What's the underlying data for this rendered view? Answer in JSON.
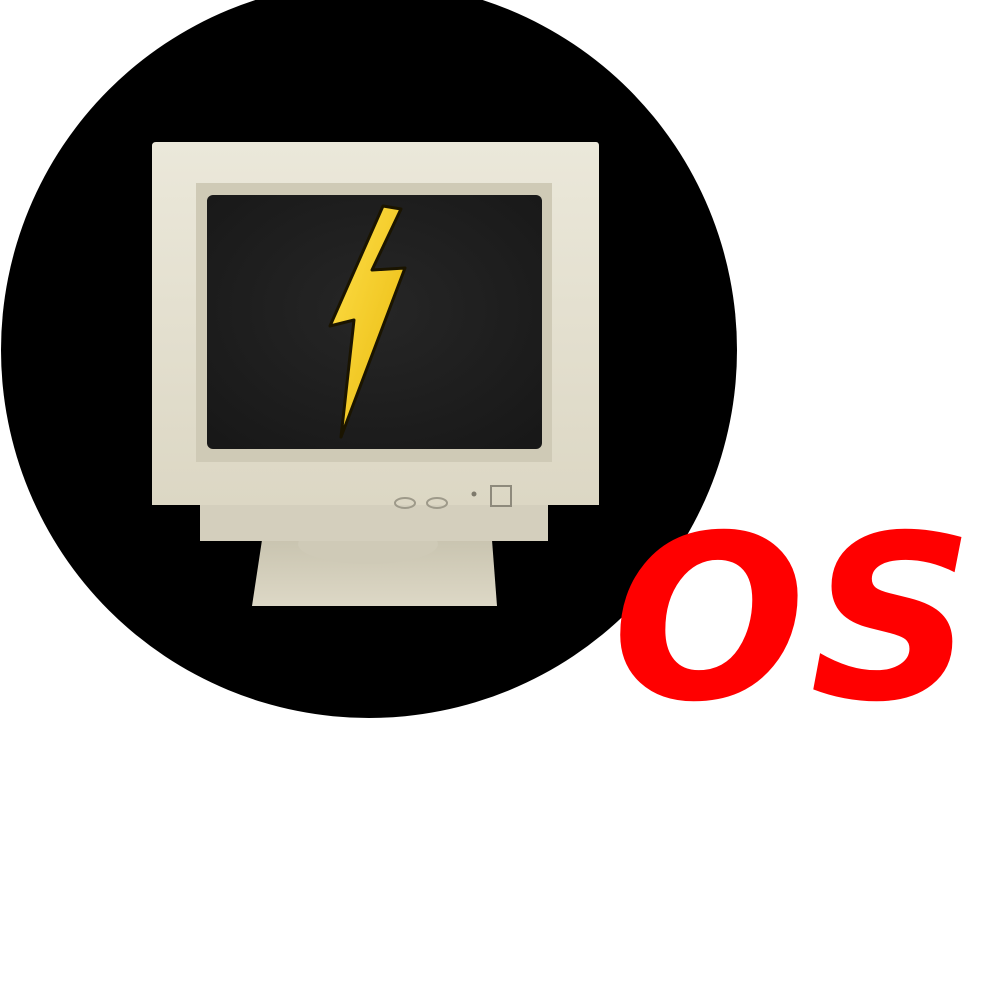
{
  "logo": {
    "wordmark": "OS",
    "icon": "crt-monitor-lightning-icon",
    "colors": {
      "circle": "#000000",
      "wordmark": "#ff0000",
      "bolt": "#f6cd1b",
      "bolt_outline": "#1a1400",
      "screen": "#1f1f1f",
      "monitor_body": "#e6e2d2",
      "monitor_shade": "#cfcab6",
      "background": "#ffffff"
    }
  }
}
